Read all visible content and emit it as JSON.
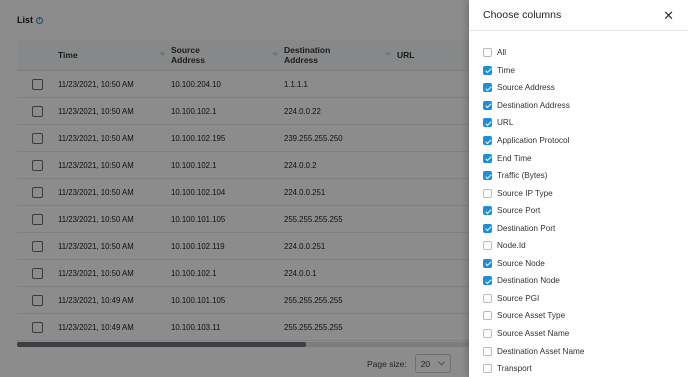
{
  "list": {
    "title": "List",
    "info_icon_glyph": "i",
    "columns": [
      "Time",
      "Source Address",
      "Destination Address",
      "URL"
    ],
    "rows": [
      {
        "time": "11/23/2021, 10:50 AM",
        "src": "10.100.204.10",
        "dst": "1.1.1.1"
      },
      {
        "time": "11/23/2021, 10:50 AM",
        "src": "10.100.102.1",
        "dst": "224.0.0.22"
      },
      {
        "time": "11/23/2021, 10:50 AM",
        "src": "10.100.102.195",
        "dst": "239.255.255.250"
      },
      {
        "time": "11/23/2021, 10:50 AM",
        "src": "10.100.102.1",
        "dst": "224.0.0.2"
      },
      {
        "time": "11/23/2021, 10:50 AM",
        "src": "10.100.102.104",
        "dst": "224.0.0.251"
      },
      {
        "time": "11/23/2021, 10:50 AM",
        "src": "10.100.101.105",
        "dst": "255.255.255.255"
      },
      {
        "time": "11/23/2021, 10:50 AM",
        "src": "10.100.102.119",
        "dst": "224.0.0.251"
      },
      {
        "time": "11/23/2021, 10:50 AM",
        "src": "10.100.102.1",
        "dst": "224.0.0.1"
      },
      {
        "time": "11/23/2021, 10:49 AM",
        "src": "10.100.101.105",
        "dst": "255.255.255.255"
      },
      {
        "time": "11/23/2021, 10:49 AM",
        "src": "10.100.103.11",
        "dst": "255.255.255.255"
      }
    ],
    "page_size_label": "Page size:",
    "page_size_value": "20",
    "column_resize_glyph": "÷"
  },
  "panel": {
    "title": "Choose columns",
    "close_glyph": "✕",
    "columns": [
      {
        "label": "All",
        "checked": false
      },
      {
        "label": "Time",
        "checked": true
      },
      {
        "label": "Source Address",
        "checked": true
      },
      {
        "label": "Destination Address",
        "checked": true
      },
      {
        "label": "URL",
        "checked": true
      },
      {
        "label": "Application Protocol",
        "checked": true
      },
      {
        "label": "End Time",
        "checked": true
      },
      {
        "label": "Traffic (Bytes)",
        "checked": true
      },
      {
        "label": "Source IP Type",
        "checked": false
      },
      {
        "label": "Source Port",
        "checked": true
      },
      {
        "label": "Destination Port",
        "checked": true
      },
      {
        "label": "Node.Id",
        "checked": false
      },
      {
        "label": "Source Node",
        "checked": true
      },
      {
        "label": "Destination Node",
        "checked": true
      },
      {
        "label": "Source PGI",
        "checked": false
      },
      {
        "label": "Source Asset Type",
        "checked": false
      },
      {
        "label": "Source Asset Name",
        "checked": false
      },
      {
        "label": "Destination Asset Name",
        "checked": false
      },
      {
        "label": "Transport",
        "checked": false
      }
    ]
  },
  "colors": {
    "accent": "#1e8fd6",
    "overlay": "rgba(0,0,0,0.45)"
  }
}
